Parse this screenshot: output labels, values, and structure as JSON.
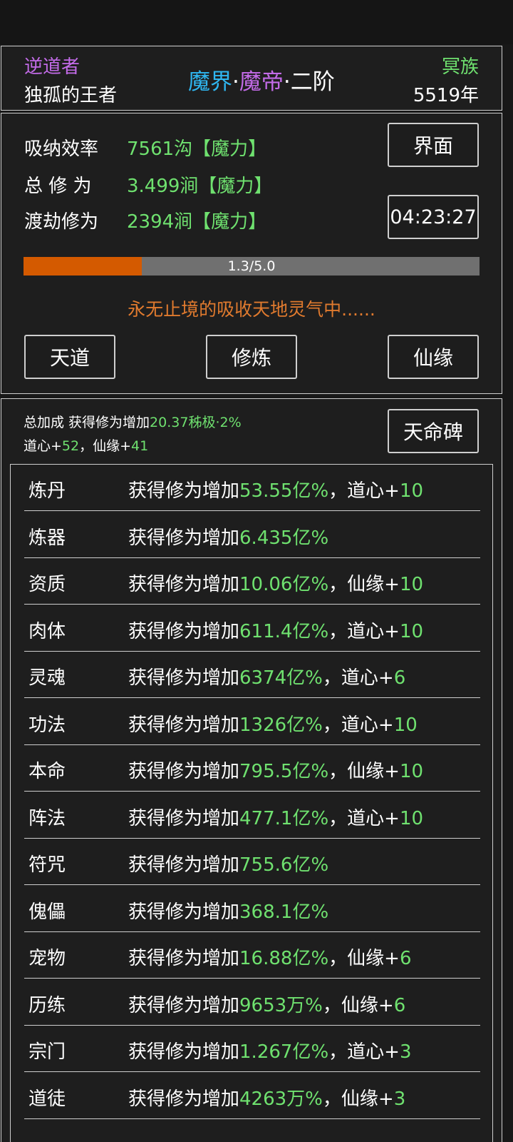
{
  "header": {
    "role": "逆道者",
    "player_name": "独孤的王者",
    "realm_world": "魔界",
    "dot1": "·",
    "realm_title": "魔帝",
    "dot2": "·",
    "realm_stage": "二阶",
    "race": "冥族",
    "age": "5519年"
  },
  "stats": {
    "absorb_label": "吸纳效率",
    "absorb_value": "7561沟【魔力】",
    "total_label": "总 修 为",
    "total_value": "3.499涧【魔力】",
    "tribulation_label": "渡劫修为",
    "tribulation_value": "2394涧【魔力】",
    "interface_button": "界面",
    "timer": "04:23:27",
    "progress_text": "1.3/5.0",
    "progress_fraction": 0.26,
    "status_text": "永无止境的吸收天地灵气中......",
    "buttons": [
      "天道",
      "修炼",
      "仙缘"
    ]
  },
  "bonus": {
    "summary_prefix": "总加成 获得修为增加",
    "summary_value": "20.37秭极·2%",
    "daoxin_label": "道心+",
    "daoxin_value": "52",
    "sep": "，",
    "xianyuan_label": "仙缘+",
    "xianyuan_value": "41",
    "stele_button": "天命碑"
  },
  "rows": [
    {
      "name": "炼丹",
      "prefix": "获得修为增加",
      "value": "53.55亿%",
      "extra_label": "，道心+",
      "extra_value": "10"
    },
    {
      "name": "炼器",
      "prefix": "获得修为增加",
      "value": "6.435亿%",
      "extra_label": "",
      "extra_value": ""
    },
    {
      "name": "资质",
      "prefix": "获得修为增加",
      "value": "10.06亿%",
      "extra_label": "，仙缘+",
      "extra_value": "10"
    },
    {
      "name": "肉体",
      "prefix": "获得修为增加",
      "value": "611.4亿%",
      "extra_label": "，道心+",
      "extra_value": "10"
    },
    {
      "name": "灵魂",
      "prefix": "获得修为增加",
      "value": "6374亿%",
      "extra_label": "，道心+",
      "extra_value": "6"
    },
    {
      "name": "功法",
      "prefix": "获得修为增加",
      "value": "1326亿%",
      "extra_label": "，道心+",
      "extra_value": "10"
    },
    {
      "name": "本命",
      "prefix": "获得修为增加",
      "value": "795.5亿%",
      "extra_label": "，仙缘+",
      "extra_value": "10"
    },
    {
      "name": "阵法",
      "prefix": "获得修为增加",
      "value": "477.1亿%",
      "extra_label": "，道心+",
      "extra_value": "10"
    },
    {
      "name": "符咒",
      "prefix": "获得修为增加",
      "value": "755.6亿%",
      "extra_label": "",
      "extra_value": ""
    },
    {
      "name": "傀儡",
      "prefix": "获得修为增加",
      "value": "368.1亿%",
      "extra_label": "",
      "extra_value": ""
    },
    {
      "name": "宠物",
      "prefix": "获得修为增加",
      "value": "16.88亿%",
      "extra_label": "，仙缘+",
      "extra_value": "6"
    },
    {
      "name": "历练",
      "prefix": "获得修为增加",
      "value": "9653万%",
      "extra_label": "，仙缘+",
      "extra_value": "6"
    },
    {
      "name": "宗门",
      "prefix": "获得修为增加",
      "value": "1.267亿%",
      "extra_label": "，道心+",
      "extra_value": "3"
    },
    {
      "name": "道徒",
      "prefix": "获得修为增加",
      "value": "4263万%",
      "extra_label": "，仙缘+",
      "extra_value": "3"
    }
  ],
  "colors": {
    "green": "#6fe16f",
    "purple": "#c36be8",
    "cyan": "#2fb6f0",
    "orange": "#e07a2e",
    "progress_fill": "#d45a00"
  }
}
